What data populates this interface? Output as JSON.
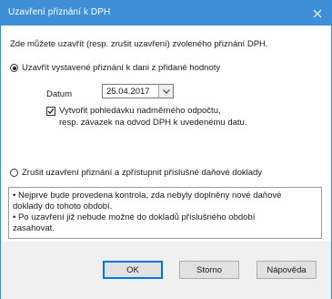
{
  "window": {
    "title": "Uzavření přiznání k DPH",
    "close_glyph": "✕"
  },
  "intro_text": "Zde můžete uzavřít (resp. zrušit uzavření) zvoleného přiznání DPH.",
  "option_close": {
    "label": "Uzavřít vystavené přiznání k dani z přidané hodnoty",
    "selected": true,
    "date_label": "Datum",
    "date_value": "25.04.2017",
    "checkbox_checked": true,
    "checkbox_line1": "Vytvořit pohledávku nadměrného odpočtu,",
    "checkbox_line2": "resp. závazek na odvod DPH k uvedenému datu."
  },
  "option_cancel": {
    "label": "Zrušit uzavření přiznání a zpřístupnit příslušné daňové doklady",
    "selected": false
  },
  "info": {
    "line1": "• Nejprve bude provedena kontrola, zda nebyly doplněny nové daňové",
    "line2": "doklady do tohoto období.",
    "line3": "• Po uzavření již nebude možné do dokladů příslušného období",
    "line4": "zasahovat."
  },
  "buttons": {
    "ok": "OK",
    "cancel": "Storno",
    "help": "Nápověda"
  },
  "colors": {
    "titlebar": "#3f8fd8",
    "default_button_border": "#0078d7"
  },
  "icons": {
    "close": "close-icon",
    "dropdown": "chevron-down-icon",
    "check": "checkmark-icon"
  }
}
